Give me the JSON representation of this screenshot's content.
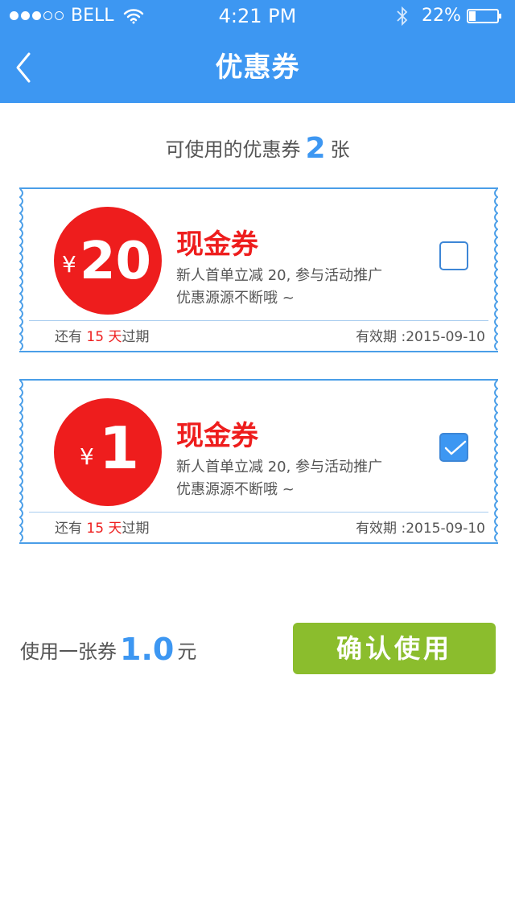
{
  "status_bar": {
    "carrier": "BELL",
    "time": "4:21 PM",
    "battery_percent": "22%",
    "signal_level": 3,
    "signal_total": 5,
    "battery_level": 0.22
  },
  "nav": {
    "title": "优惠券",
    "back_icon": "chevron-left-icon"
  },
  "summary": {
    "prefix": "可使用的优惠券",
    "count": "2",
    "suffix": "张"
  },
  "coupons": [
    {
      "currency": "¥",
      "amount": "20",
      "name": "现金券",
      "description": "新人首单立减 20, 参与活动推广",
      "note": "优惠源源不断哦 ~",
      "expiry_prefix": "还有",
      "expiry_days": "15 天",
      "expiry_suffix": "过期",
      "valid_until": "有效期 :2015-09-10",
      "checked": false
    },
    {
      "currency": "¥",
      "amount": "1",
      "name": "现金券",
      "description": "新人首单立减 20, 参与活动推广",
      "note": "优惠源源不断哦 ~",
      "expiry_prefix": "还有",
      "expiry_days": "15 天",
      "expiry_suffix": "过期",
      "valid_until": "有效期 :2015-09-10",
      "checked": true
    }
  ],
  "usage": {
    "prefix": "使用一张券",
    "amount": "1.0",
    "suffix": "元"
  },
  "confirm_button": {
    "label": "确认使用"
  },
  "colors": {
    "header": "#3d97f2",
    "accent_blue": "#3d97f2",
    "accent_red": "#ee1d1d",
    "button_green": "#8bbd2d"
  }
}
